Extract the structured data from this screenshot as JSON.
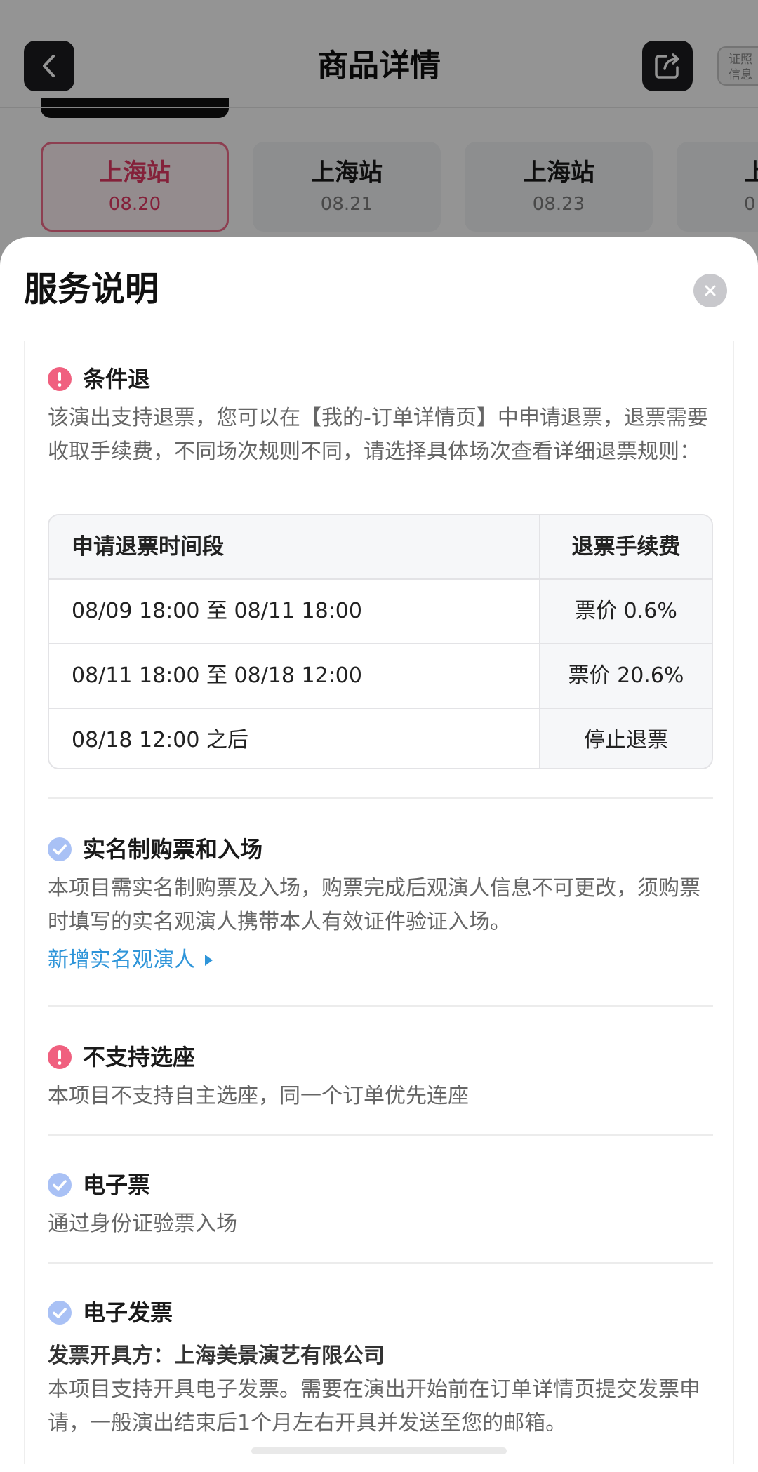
{
  "header": {
    "title": "商品详情",
    "license_badge": [
      "证照",
      "信息"
    ]
  },
  "date_tabs": [
    {
      "city": "上海站",
      "date": "08.20",
      "selected": true
    },
    {
      "city": "上海站",
      "date": "08.21",
      "selected": false
    },
    {
      "city": "上海站",
      "date": "08.23",
      "selected": false
    },
    {
      "city": "上",
      "date": "0",
      "selected": false
    }
  ],
  "sheet": {
    "title": "服务说明",
    "refund": {
      "title": "条件退",
      "description": "该演出支持退票，您可以在【我的-订单详情页】中申请退票，退票需要收取手续费，不同场次规则不同，请选择具体场次查看详细退票规则：",
      "table": {
        "headers": [
          "申请退票时间段",
          "退票手续费"
        ],
        "rows": [
          [
            "08/09 18:00 至 08/11 18:00",
            "票价 0.6%"
          ],
          [
            "08/11 18:00 至 08/18 12:00",
            "票价 20.6%"
          ],
          [
            "08/18 12:00 之后",
            "停止退票"
          ]
        ]
      }
    },
    "realname": {
      "title": "实名制购票和入场",
      "description": "本项目需实名制购票及入场，购票完成后观演人信息不可更改，须购票时填写的实名观演人携带本人有效证件验证入场。",
      "link": "新增实名观演人"
    },
    "seat": {
      "title": "不支持选座",
      "description": "本项目不支持自主选座，同一个订单优先连座"
    },
    "eticket": {
      "title": "电子票",
      "description": "通过身份证验票入场"
    },
    "invoice": {
      "title": "电子发票",
      "issuer": "发票开具方：上海美景演艺有限公司",
      "description": "本项目支持开具电子发票。需要在演出开始前在订单详情页提交发票申请，一般演出结束后1个月左右开具并发送至您的邮箱。"
    }
  },
  "colors": {
    "accent_pink": "#e33a65",
    "warn_icon": "#f0607f",
    "ok_icon": "#a9c1f5",
    "link_blue": "#2f95d9"
  },
  "icons": {
    "back": "chevron-left-icon",
    "share": "share-icon",
    "close": "close-icon",
    "warn": "exclamation-icon",
    "ok": "check-icon"
  }
}
